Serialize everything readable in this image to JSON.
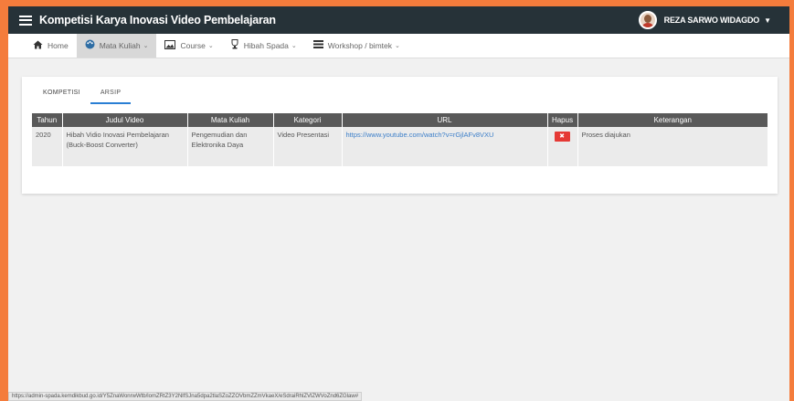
{
  "app": {
    "title": "Kompetisi Karya Inovasi Video Pembelajaran"
  },
  "user": {
    "name": "REZA SARWO WIDAGDO",
    "caret": "⌄"
  },
  "nav": {
    "items": [
      {
        "label": "Home",
        "icon": "home-icon",
        "has_caret": false
      },
      {
        "label": "Mata Kuliah",
        "icon": "palette-icon",
        "has_caret": true
      },
      {
        "label": "Course",
        "icon": "image-icon",
        "has_caret": true
      },
      {
        "label": "Hibah Spada",
        "icon": "trophy-icon",
        "has_caret": true
      },
      {
        "label": "Workshop / bimtek",
        "icon": "list-icon",
        "has_caret": true
      }
    ],
    "active_index": 1
  },
  "tabs": [
    {
      "label": "KOMPETISI"
    },
    {
      "label": "ARSIP"
    }
  ],
  "active_tab": 1,
  "table": {
    "headers": [
      "Tahun",
      "Judul Video",
      "Mata Kuliah",
      "Kategori",
      "URL",
      "Hapus",
      "Keterangan"
    ],
    "rows": [
      {
        "tahun": "2020",
        "judul": "Hibah Vidio Inovasi Pembelajaran (Buck-Boost Converter)",
        "mata_kuliah": "Pengemudian dan Elektronika Daya",
        "kategori": "Video Presentasi",
        "url": "https://www.youtube.com/watch?v=rGjlAFv8VXU",
        "hapus_label": "✖",
        "keterangan": "Proses diajukan"
      }
    ]
  },
  "status_bar": {
    "text": "https://admin-spada.kemdikbud.go.id/Y5ZnaWonrwWtb/lomZRtZ3Y2NlfSJna5dpa2tlaSZoZZOVbmZZmVkaeX/eSdraiRhlZVlZWVoZnd6ZGlaw#"
  },
  "colors": {
    "outer_border": "#f47c3c",
    "topbar": "#263238",
    "table_header": "#595959",
    "tab_underline": "#2a7fd4",
    "delete_button": "#e53935",
    "link": "#3d7fc9"
  }
}
